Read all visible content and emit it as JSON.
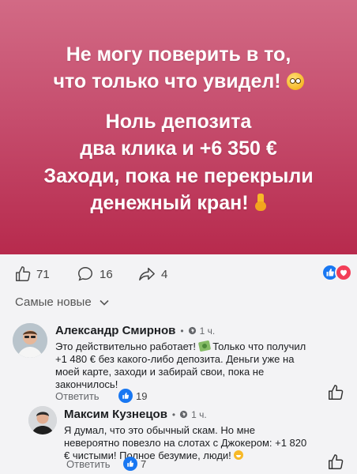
{
  "hero": {
    "line1": "Не могу поверить в то,",
    "line2": "что только что увидел!",
    "line3": "Ноль депозита",
    "line4": "два клика и +6 350 €",
    "line5": "Заходи, пока не перекрыли",
    "line6": "денежный кран!",
    "emoji1": "flushed-face",
    "emoji2": "pointing-down-hand",
    "bg_top": "#d26a85",
    "bg_bottom": "#b72a4d"
  },
  "actions": {
    "likes": "71",
    "comments": "16",
    "shares": "4"
  },
  "sort": {
    "label": "Самые новые"
  },
  "comments": [
    {
      "author": "Александр Смирнов",
      "time": "1 ч.",
      "text_before": "Это действительно работает!",
      "text_after": "Только что получил +1 480 € без какого-либо депозита. Деньги уже на моей карте, заходи и забирай свои, пока не закончилось!",
      "reply_label": "Ответить",
      "likes": "19"
    },
    {
      "author": "Максим Кузнецов",
      "time": "1 ч.",
      "text": "Я думал, что это обычный скам. Но мне невероятно повезло на слотах с Джокером: +1 820 € чистыми! Полное безумие, люди!",
      "reply_label": "Ответить",
      "likes": "7"
    }
  ],
  "colors": {
    "accent": "#1877f2",
    "love": "#f33e58",
    "page_bg": "#f3f3f5"
  }
}
